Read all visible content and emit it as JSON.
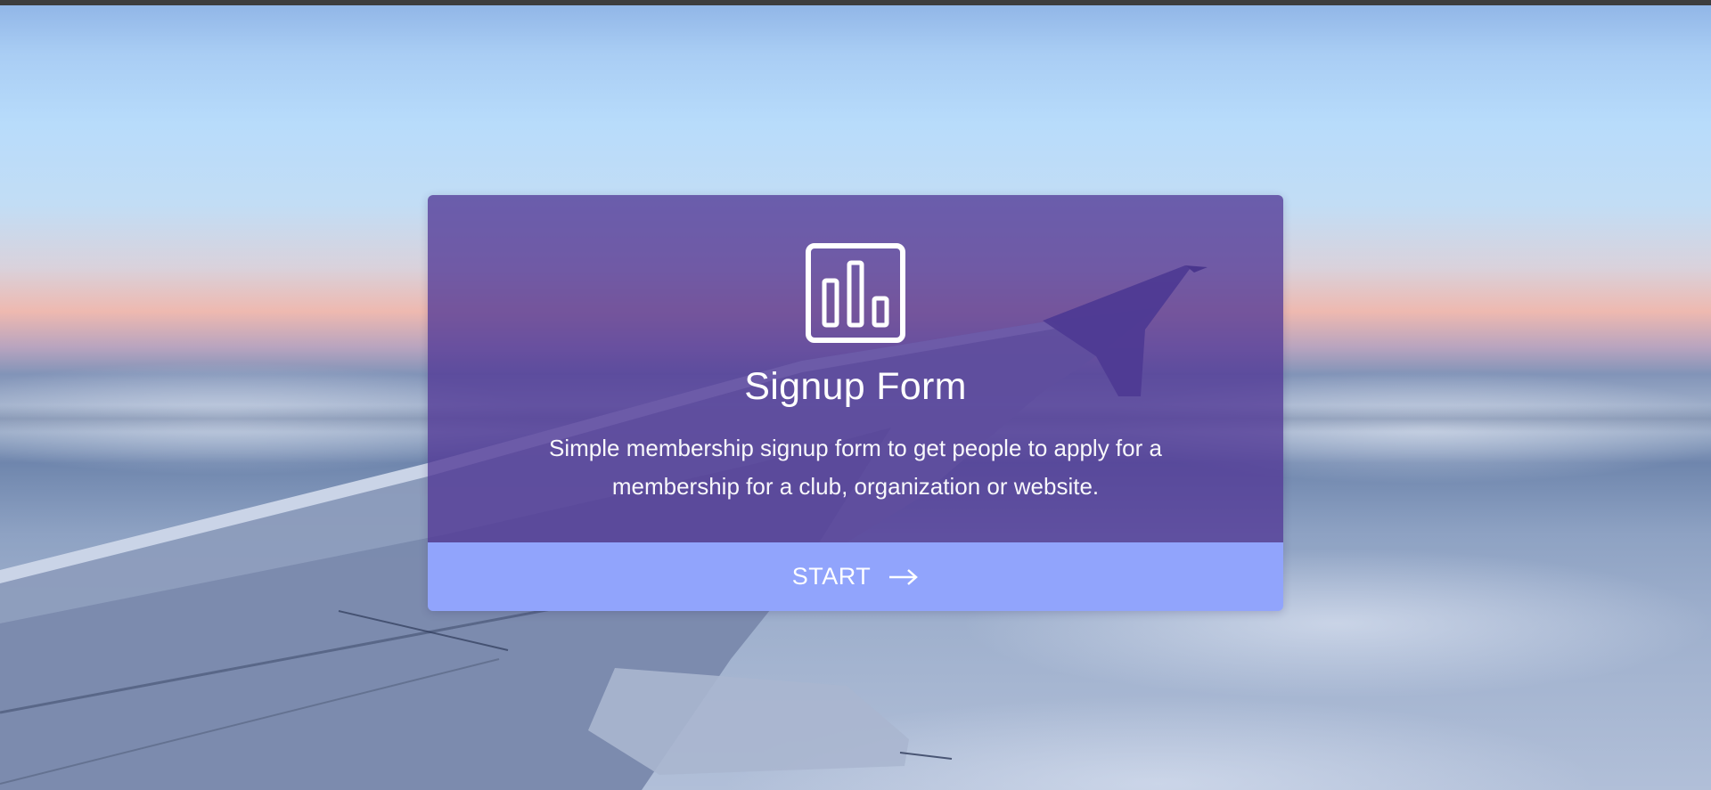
{
  "card": {
    "icon": "bar-chart-icon",
    "title": "Signup Form",
    "description": "Simple membership signup form to get people to apply for a membership for a club, organization or website."
  },
  "start_button": {
    "label": "START",
    "icon": "arrow-right-icon"
  },
  "colors": {
    "card_overlay": "#5238961",
    "button": "#91a4fc",
    "text": "#ffffff",
    "top_bar": "#3d3d3d"
  }
}
